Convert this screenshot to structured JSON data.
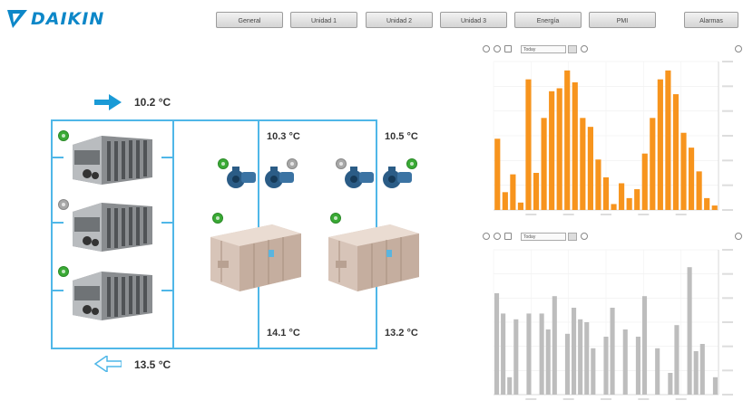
{
  "brand": {
    "name": "DAIKIN",
    "color": "#0d87c8"
  },
  "nav": {
    "items": [
      {
        "label": "General"
      },
      {
        "label": "Unidad 1"
      },
      {
        "label": "Unidad 2"
      },
      {
        "label": "Unidad 3"
      },
      {
        "label": "Energía"
      },
      {
        "label": "PMI"
      },
      {
        "label": "Alarmas"
      }
    ]
  },
  "schematic": {
    "supply_temp": "10.2 °C",
    "return_temp": "13.5 °C",
    "branch1_in_temp": "10.3 °C",
    "branch2_in_temp": "10.5 °C",
    "branch1_out_temp": "14.1 °C",
    "branch2_out_temp": "13.2 °C",
    "supply_arrow_icon": "arrow-right-icon",
    "return_arrow_icon": "arrow-left-icon",
    "pipe_color": "#4fb7e8",
    "status_colors": {
      "running": "#3aaa35",
      "stopped": "#a8a8a8"
    },
    "chillers": [
      {
        "status": "running"
      },
      {
        "status": "stopped"
      },
      {
        "status": "running"
      }
    ],
    "pumps": [
      {
        "status": "running"
      },
      {
        "status": "stopped"
      },
      {
        "status": "stopped"
      },
      {
        "status": "running"
      }
    ],
    "ahus": [
      {
        "status": "running"
      },
      {
        "status": "running"
      }
    ]
  },
  "charts": {
    "top": {
      "range_select": "Today",
      "bar_color": "#f7941d"
    },
    "bottom": {
      "range_select": "Today",
      "bar_color": "#bdbdbd"
    }
  },
  "chart_data": [
    {
      "type": "bar",
      "color": "#f7941d",
      "values": [
        48,
        12,
        24,
        5,
        88,
        25,
        62,
        80,
        82,
        94,
        86,
        62,
        56,
        34,
        22,
        4,
        18,
        8,
        14,
        38,
        62,
        88,
        94,
        78,
        52,
        42,
        26,
        8,
        3
      ],
      "ylim": [
        0,
        100
      ],
      "grid": true
    },
    {
      "type": "bar",
      "color": "#bdbdbd",
      "values": [
        70,
        56,
        12,
        52,
        0,
        56,
        0,
        56,
        45,
        68,
        0,
        42,
        60,
        52,
        50,
        32,
        0,
        40,
        60,
        0,
        45,
        0,
        40,
        68,
        0,
        32,
        0,
        15,
        48,
        0,
        88,
        30,
        35,
        0,
        12
      ],
      "ylim": [
        0,
        100
      ],
      "grid": true
    }
  ]
}
